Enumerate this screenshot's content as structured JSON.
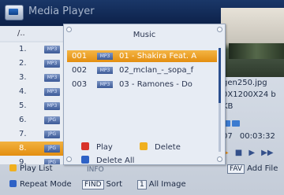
{
  "app": {
    "title": "Media Player"
  },
  "file_list": {
    "up_label": "/..",
    "rows": [
      {
        "num": "1.",
        "type": "MP3"
      },
      {
        "num": "2.",
        "type": "MP3"
      },
      {
        "num": "3.",
        "type": "MP3"
      },
      {
        "num": "4.",
        "type": "MP3"
      },
      {
        "num": "5.",
        "type": "MP3"
      },
      {
        "num": "6.",
        "type": "JPG"
      },
      {
        "num": "7.",
        "type": "JPG"
      },
      {
        "num": "8.",
        "type": "JPG"
      },
      {
        "num": "9.",
        "type": "JPG"
      }
    ],
    "selected_row": 7
  },
  "info": {
    "filename": "gen250.jpg",
    "resolution": "0X1200X24 b",
    "size": "KB",
    "time_left": "07",
    "time_total": "00:03:32"
  },
  "dialog": {
    "title": "Music",
    "tracks": [
      {
        "index": "001",
        "type": "MP3",
        "name": "01 - Shakira Feat. A"
      },
      {
        "index": "002",
        "type": "MP3",
        "name": "02_mclan_-_sopa_f"
      },
      {
        "index": "003",
        "type": "MP3",
        "name": "03 - Ramones - Do"
      }
    ],
    "selected_track": 0,
    "actions": {
      "play": "Play",
      "delete": "Delete",
      "delete_all": "Delete All"
    }
  },
  "legend": {
    "play_list": "Play List",
    "info_fragment": "INFO",
    "fav": "FAV",
    "add_file": "Add File",
    "repeat_mode": "Repeat Mode",
    "find": "FIND",
    "sort": "Sort",
    "one": "1",
    "all_image": "All Image"
  },
  "colors": {
    "selection": "#e38e10",
    "title_bar": "#0c2048",
    "red_key": "#d8332a",
    "yellow_key": "#f0b020",
    "blue_key": "#2e62c6"
  }
}
